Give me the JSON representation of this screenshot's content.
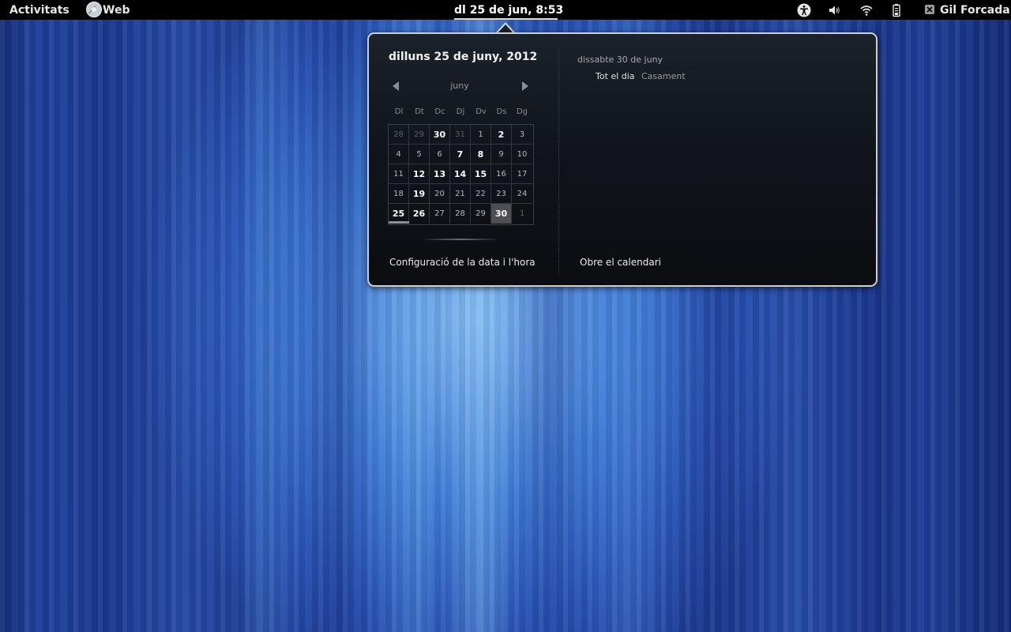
{
  "topbar": {
    "activities_label": "Activitats",
    "app_name": "Web",
    "app_icon": "web-browser-icon",
    "clock": "dl 25 de jun,  8:53",
    "status_icons": [
      "accessibility-icon",
      "volume-icon",
      "wifi-icon",
      "battery-icon"
    ],
    "user_name": "Gil Forcada",
    "user_icon": "user-status-icon"
  },
  "calendar": {
    "full_date": "dilluns 25 de juny, 2012",
    "month": "juny",
    "weekdays": [
      "Dl",
      "Dt",
      "Dc",
      "Dj",
      "Dv",
      "Ds",
      "Dg"
    ],
    "weeks": [
      [
        "28",
        "29",
        "30",
        "31",
        "1",
        "2",
        "3"
      ],
      [
        "4",
        "5",
        "6",
        "7",
        "8",
        "9",
        "10"
      ],
      [
        "11",
        "12",
        "13",
        "14",
        "15",
        "16",
        "17"
      ],
      [
        "18",
        "19",
        "20",
        "21",
        "22",
        "23",
        "24"
      ],
      [
        "25",
        "26",
        "27",
        "28",
        "29",
        "30",
        "1"
      ]
    ],
    "settings_link": "Configuració de la data i l'hora",
    "open_calendar_link": "Obre el calendari"
  },
  "events": {
    "day_heading": "dissabte 30 de juny",
    "items": [
      {
        "time": "Tot el dia",
        "title": "Casament"
      }
    ]
  },
  "colors": {
    "popup_background": "#11151b",
    "selected_day": "#4d4f53",
    "topbar": "#000000"
  }
}
